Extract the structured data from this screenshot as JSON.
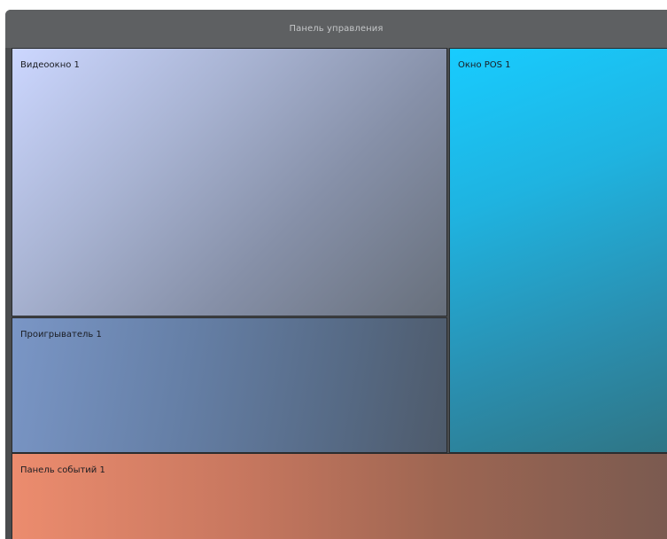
{
  "control_panel": {
    "title": "Панель управления"
  },
  "panes": {
    "video_window": {
      "label": "Видеоокно 1"
    },
    "player": {
      "label": "Проигрыватель 1"
    },
    "pos_window": {
      "label": "Окно POS 1"
    },
    "events_panel": {
      "label": "Панель событий 1"
    }
  },
  "colors": {
    "frame_background": "#4a4c4e",
    "control_panel_background": "#5e6062",
    "video_window_gradient": [
      "#ccd7ff",
      "#676f7b"
    ],
    "player_gradient": [
      "#7a96c6",
      "#4e5a6a"
    ],
    "pos_window_gradient": [
      "#18ccff",
      "#2f7585"
    ],
    "events_panel_gradient": [
      "#ec8c6e",
      "#7a5a50"
    ]
  }
}
